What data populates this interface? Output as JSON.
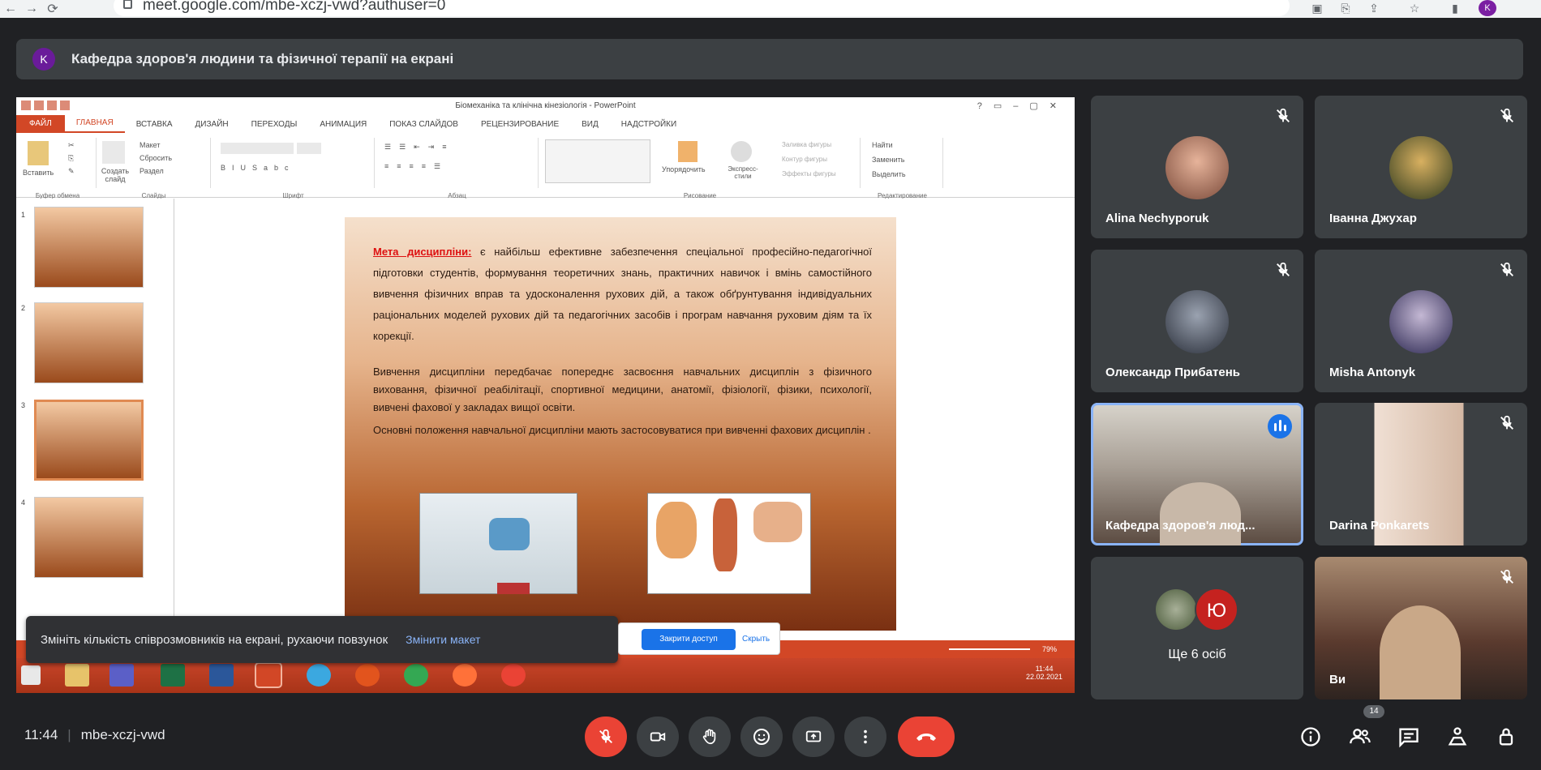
{
  "browser": {
    "url": "meet.google.com/mbe-xczj-vwd?authuser=0",
    "profile_initial": "K"
  },
  "banner": {
    "avatar_initial": "K",
    "text": "Кафедра здоров'я людини та фізичної терапії на екрані"
  },
  "ppt": {
    "title": "Біомеханіка та клінічна кінезіологія - PowerPoint",
    "tabs": [
      "ФАЙЛ",
      "ГЛАВНАЯ",
      "ВСТАВКА",
      "ДИЗАЙН",
      "ПЕРЕХОДЫ",
      "АНИМАЦИЯ",
      "ПОКАЗ СЛАЙДОВ",
      "РЕЦЕНЗИРОВАНИЕ",
      "ВИД",
      "НАДСТРОЙКИ"
    ],
    "ribbon": {
      "paste": "Вставить",
      "create_slide": "Создать слайд",
      "layout": "Макет",
      "reset": "Сбросить",
      "section": "Раздел",
      "group_clipboard": "Буфер обмена",
      "group_slides": "Слайды",
      "group_font": "Шрифт",
      "group_paragraph": "Абзац",
      "group_drawing": "Рисование",
      "group_editing": "Редактирование",
      "arrange": "Упорядочить",
      "express_styles": "Экспресс-стили",
      "shape_fill": "Заливка фигуры",
      "shape_outline": "Контур фигуры",
      "shape_effects": "Эффекты фигуры",
      "find": "Найти",
      "replace": "Заменить",
      "select": "Выделить"
    },
    "thumb_numbers": [
      "1",
      "2",
      "3",
      "4"
    ],
    "slide": {
      "highlight": "Мета дисципліни:",
      "para1": "є найбільш ефективне забезпечення спеціальної професійно-педагогічної підготовки студентів, формування теоретичних знань, практичних навичок і вмінь самостійного вивчення фізичних вправ та удосконалення рухових дій, а також обґрунтування індивідуальних раціональних моделей рухових дій та педагогічних засобів і програм навчання руховим діям та їх корекції.",
      "para2": "Вивчення дисципліни передбачає попереднє засвоєння навчальних дисциплін з фізичного виховання, фізичної реабілітації, спортивної медицини, анатомії, фізіології, фізики, психології, вивчені фахової у закладах вищої освіти.",
      "para3": "Основні положення навчальної дисципліни мають застосовуватися при вивченні фахових дисциплін ."
    },
    "status_zoom": "79%",
    "clock_time": "11:44",
    "clock_date": "22.02.2021"
  },
  "toast": {
    "message": "Змініть кількість співрозмовників на екрані, рухаючи повзунок",
    "action": "Змінити макет"
  },
  "share_prompt": {
    "primary": "Закрити доступ",
    "secondary": "Скрыть"
  },
  "participants": [
    {
      "name": "Alina Nechyporuk"
    },
    {
      "name": "Іванна Джухар"
    },
    {
      "name": "Олександр Прибатень"
    },
    {
      "name": "Misha Antonyk"
    },
    {
      "name": "Кафедра здоров'я люд..."
    },
    {
      "name": "Darina Ponkarets"
    },
    {
      "name": "Ще 6 осіб",
      "avatar_initial": "Ю"
    },
    {
      "name": "Ви"
    }
  ],
  "meeting": {
    "time": "11:44",
    "code": "mbe-xczj-vwd",
    "people_count": "14"
  },
  "colors": {
    "end_call": "#ea4335",
    "accent": "#8ab4f8",
    "ppt_orange": "#d24726"
  }
}
